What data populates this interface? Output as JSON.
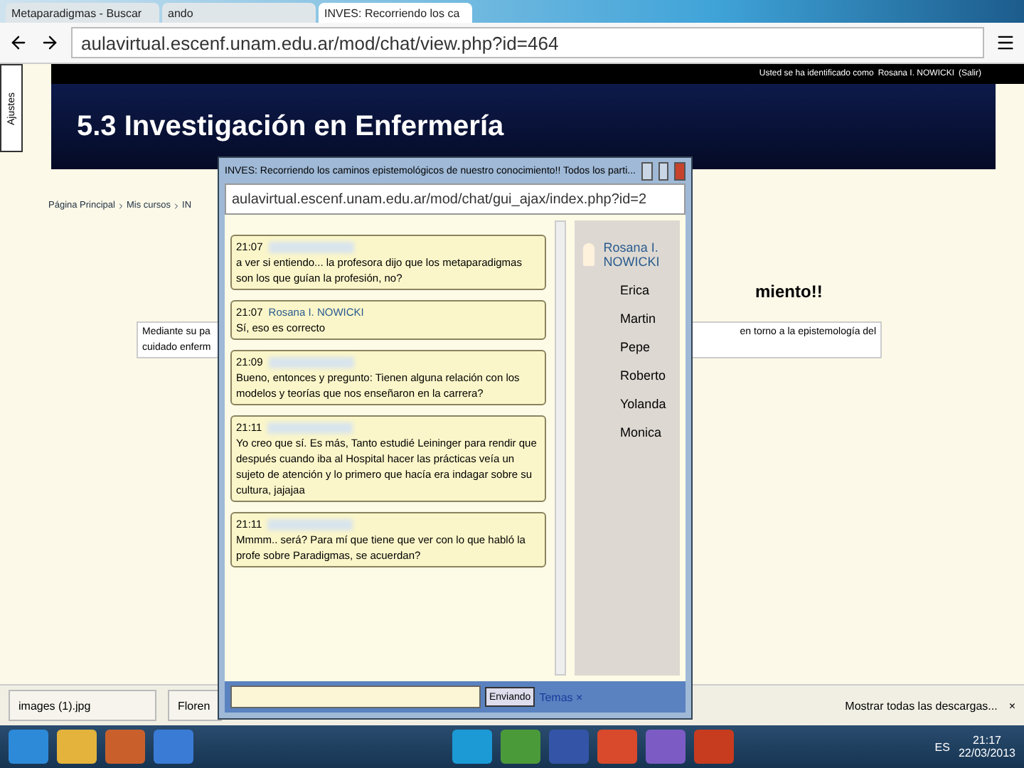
{
  "browser": {
    "tabs": [
      {
        "label": "Metaparadigmas - Buscar",
        "selected": false
      },
      {
        "label": "ando",
        "selected": false
      },
      {
        "label": "INVES: Recorriendo los ca",
        "selected": true
      }
    ],
    "address": "aulavirtual.escenf.unam.edu.ar/mod/chat/view.php?id=464"
  },
  "page": {
    "side_tab": "Ajustes",
    "login_text": "Usted se ha identificado como",
    "login_user": "Rosana I. NOWICKI",
    "logout": "(Salir)",
    "course_title": "5.3 Investigación en Enfermería",
    "breadcrumb": [
      "Página Principal",
      "Mis cursos",
      "IN"
    ],
    "heading_tail": "miento!!",
    "intro_left": "Mediante su pa",
    "intro_right": "en torno a la epistemología del",
    "intro_left_2": "cuidado enferm"
  },
  "popup": {
    "title": "INVES: Recorriendo los caminos epistemológicos de nuestro conocimiento!! Todos los parti...",
    "address": "aulavirtual.escenf.unam.edu.ar/mod/chat/gui_ajax/index.php?id=2",
    "messages": [
      {
        "time": "21:07",
        "text": "a ver si entiendo... la profesora dijo que los metaparadigmas son los que guían la profesión, no?"
      },
      {
        "time": "21:07",
        "author": "Rosana I. NOWICKI",
        "text": "Sí, eso es correcto"
      },
      {
        "time": "21:09",
        "text": "Bueno, entonces y pregunto: Tienen alguna relación con los modelos y teorías que nos enseñaron en la carrera?"
      },
      {
        "time": "21:11",
        "text": "Yo creo que sí. Es más, Tanto estudié Leininger para rendir que después cuando iba al Hospital hacer las prácticas veía un sujeto de atención y lo primero que hacía era indagar sobre su cultura, jajajaa"
      },
      {
        "time": "21:11",
        "text": "Mmmm.. será? Para mí que tiene que ver con lo que habló la profe sobre Paradigmas, se acuerdan?"
      }
    ],
    "me": "Rosana I. NOWICKI",
    "users": [
      "Erica",
      "Martin",
      "Pepe",
      "Roberto",
      "Yolanda",
      "Monica"
    ],
    "send": "Enviando",
    "themes": "Temas ×"
  },
  "downloads": {
    "items": [
      "images (1).jpg",
      "Floren"
    ],
    "show_all": "Mostrar todas las descargas...",
    "close": "×"
  },
  "taskbar": {
    "lang": "ES",
    "time": "21:17",
    "date": "22/03/2013"
  }
}
